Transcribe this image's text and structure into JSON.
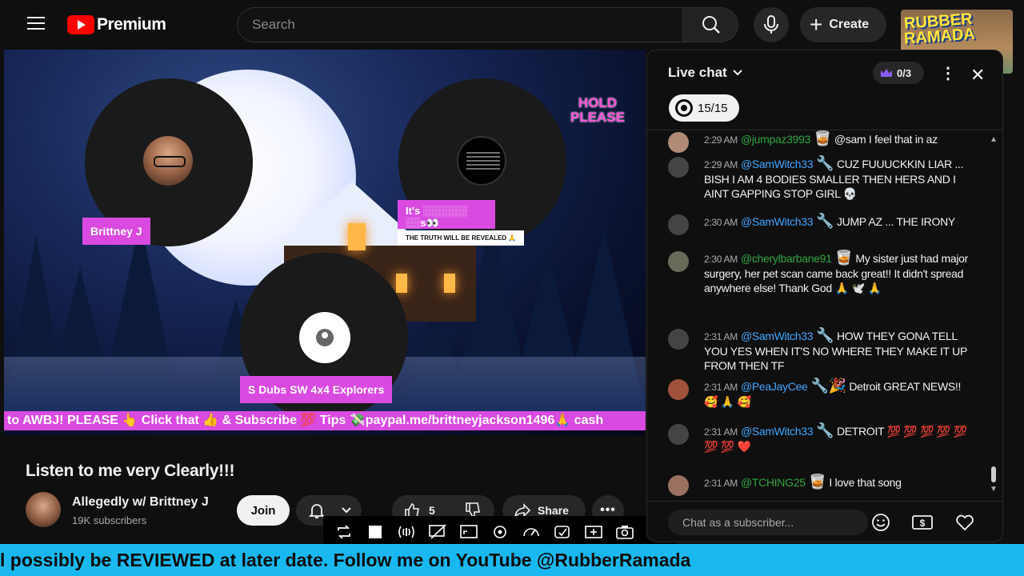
{
  "topbar": {
    "logo_text": "Premium",
    "search_placeholder": "Search",
    "create_label": "Create",
    "rr_logo_line1": "RUBBER",
    "rr_logo_line2": "RAMADA"
  },
  "stream": {
    "hold_line1": "HOLD",
    "hold_line2": "PLEASE",
    "guest1_name": "Brittney J",
    "guest2_caption": "It's ░░░░░░ ░░s👀",
    "guest2_subcaption": "THE TRUTH WILL BE REVEALED 🙏",
    "guest3_name": "S Dubs SW 4x4 Explorers",
    "ticker": "to AWBJ! PLEASE 👆 Click that 👍 & Subscribe 💯 Tips 💸paypal.me/brittneyjackson1496🙏 cash"
  },
  "video": {
    "title": "Listen to me very Clearly!!!",
    "channel_name": "Allegedly w/ Brittney J",
    "subscribers": "19K subscribers",
    "join_label": "Join",
    "like_count": "5",
    "share_label": "Share"
  },
  "chat": {
    "title": "Live chat",
    "crown_count": "0/3",
    "poll_count": "15/15",
    "input_placeholder": "Chat as a subscriber...",
    "messages": [
      {
        "time": "2:29 AM",
        "author": "@jumpaz3993",
        "badge": "🥃",
        "text": "@sam I feel that in az"
      },
      {
        "time": "2:29 AM",
        "author": "@SamWitch33",
        "badge": "🔧",
        "text": "CUZ FUUUCKKIN LIAR ... BISH I AM 4 BODIES SMALLER THEN HERS AND I AINT GAPPING STOP GIRL 💀"
      },
      {
        "time": "2:30 AM",
        "author": "@SamWitch33",
        "badge": "🔧",
        "text": "JUMP AZ ... THE IRONY"
      },
      {
        "time": "2:30 AM",
        "author": "@cherylbarbane91",
        "badge": "🥃",
        "text": "My sister just had major surgery, her pet scan came back great!! It didn't spread anywhere else! Thank God 🙏 🕊️ 🙏"
      },
      {
        "time": "2:31 AM",
        "author": "@SamWitch33",
        "badge": "🔧",
        "text": "HOW THEY GONA TELL YOU YES WHEN IT'S NO WHERE THEY MAKE IT UP FROM THEN TF"
      },
      {
        "time": "2:31 AM",
        "author": "@PeaJayCee",
        "badge": "🔧🎉",
        "text": "Detroit GREAT NEWS!! 🥰 🙏 🥰"
      },
      {
        "time": "2:31 AM",
        "author": "@SamWitch33",
        "badge": "🔧",
        "text": "DETROIT 💯 💯 💯 💯 💯 💯 💯 ❤️"
      },
      {
        "time": "2:31 AM",
        "author": "@TCHING25",
        "badge": "🥃",
        "text": "I love that song"
      }
    ]
  },
  "banner": {
    "text": "l possibly be REVIEWED at later date. Follow me on YouTube @RubberRamada"
  },
  "colors": {
    "accent_pink": "#d94ae0",
    "banner_blue": "#19b8f0",
    "link_blue": "#3ea6ff",
    "member_green": "#2ba640"
  },
  "icons": [
    "menu-icon",
    "youtube-logo-icon",
    "search-icon",
    "mic-icon",
    "plus-icon",
    "bell-icon",
    "chevron-down-icon",
    "like-icon",
    "dislike-icon",
    "share-icon",
    "more-icon",
    "crown-icon",
    "close-icon",
    "poll-icon",
    "emoji-icon",
    "dollar-icon",
    "heart-icon"
  ]
}
